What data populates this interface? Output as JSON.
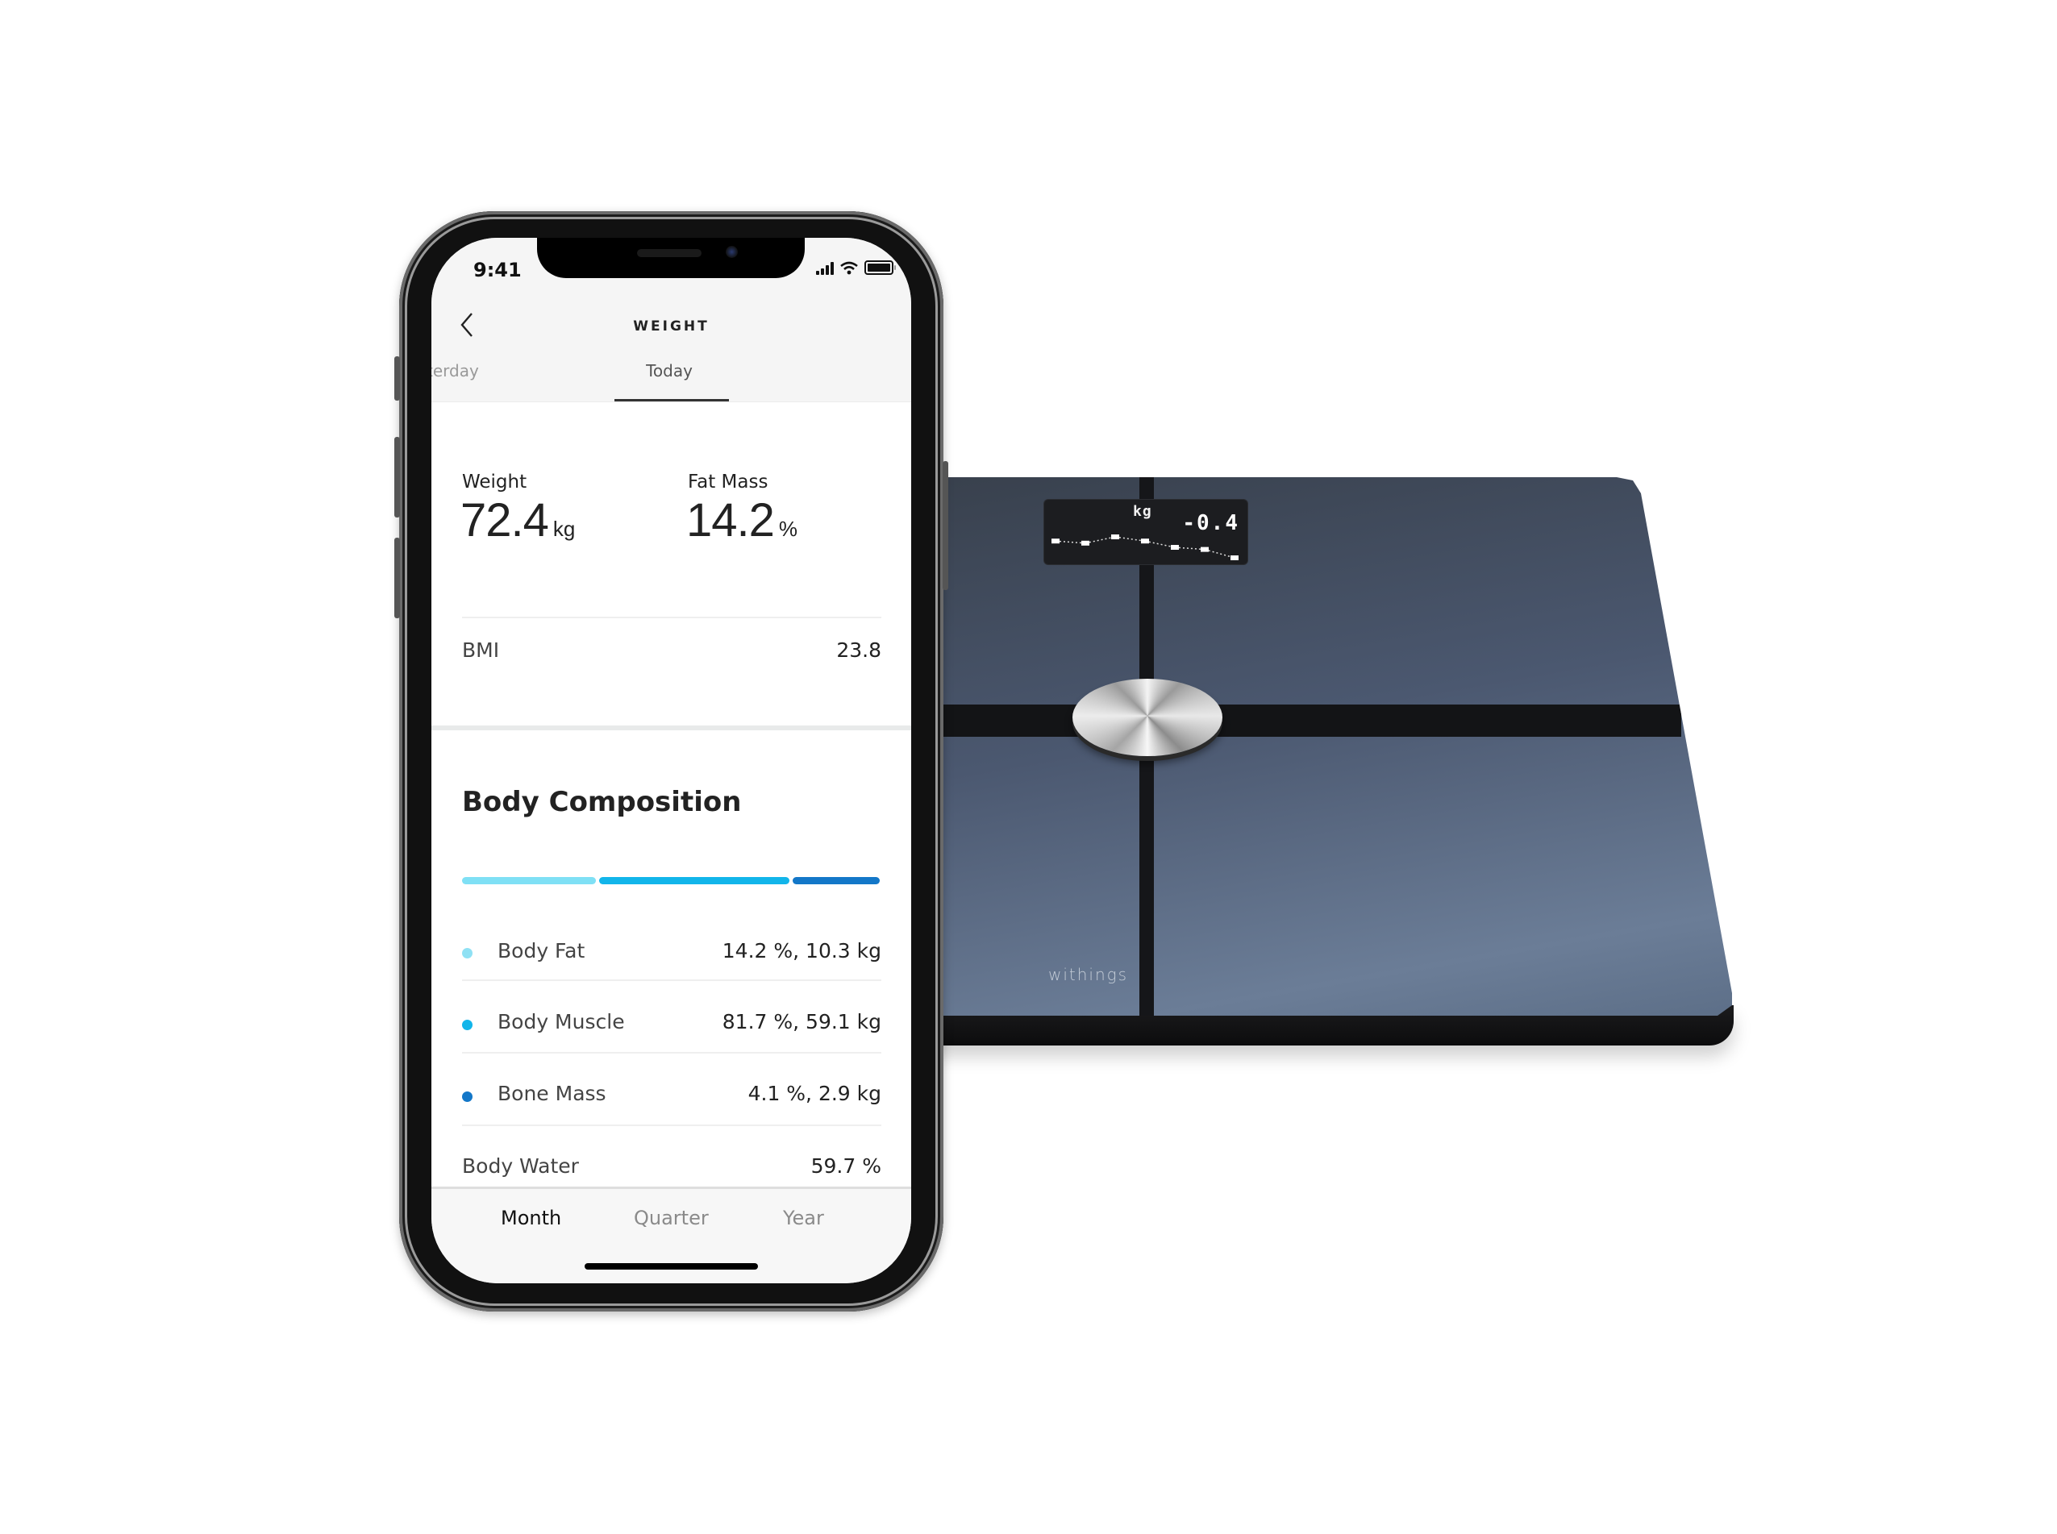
{
  "status_bar": {
    "time": "9:41",
    "icons": [
      "cellular-signal-icon",
      "wifi-icon",
      "battery-icon"
    ]
  },
  "header": {
    "title": "WEIGHT",
    "back_icon": "chevron-left-icon"
  },
  "day_tabs": {
    "previous_label": "terday",
    "current_label": "Today"
  },
  "summary": {
    "weight": {
      "label": "Weight",
      "value": "72.4",
      "unit": "kg"
    },
    "fat_mass": {
      "label": "Fat Mass",
      "value": "14.2",
      "unit": "%"
    },
    "bmi": {
      "label": "BMI",
      "value": "23.8"
    }
  },
  "body_composition": {
    "title": "Body Composition",
    "bar": [
      {
        "name": "Body Fat",
        "fraction": 0.325,
        "color": "#7fe0f5"
      },
      {
        "name": "Body Muscle",
        "fraction": 0.46,
        "color": "#12b5ea"
      },
      {
        "name": "Bone Mass",
        "fraction": 0.215,
        "color": "#1377c8"
      }
    ],
    "items": [
      {
        "label": "Body Fat",
        "value": "14.2 %, 10.3 kg",
        "dot_color": "#8fe1f4"
      },
      {
        "label": "Body Muscle",
        "value": "81.7 %, 59.1 kg",
        "dot_color": "#12b5ea"
      },
      {
        "label": "Bone Mass",
        "value": "4.1 %, 2.9 kg",
        "dot_color": "#1377c8"
      }
    ],
    "body_water": {
      "label": "Body Water",
      "value": "59.7 %"
    }
  },
  "period_tabs": [
    {
      "label": "Month",
      "active": true
    },
    {
      "label": "Quarter",
      "active": false
    },
    {
      "label": "Year",
      "active": false
    }
  ],
  "scale": {
    "display_unit": "kg",
    "display_value": "-0.4",
    "trend_points": [
      0.2,
      0.3,
      0.0,
      0.2,
      0.5,
      0.6,
      1.0
    ],
    "brand": "withings"
  }
}
